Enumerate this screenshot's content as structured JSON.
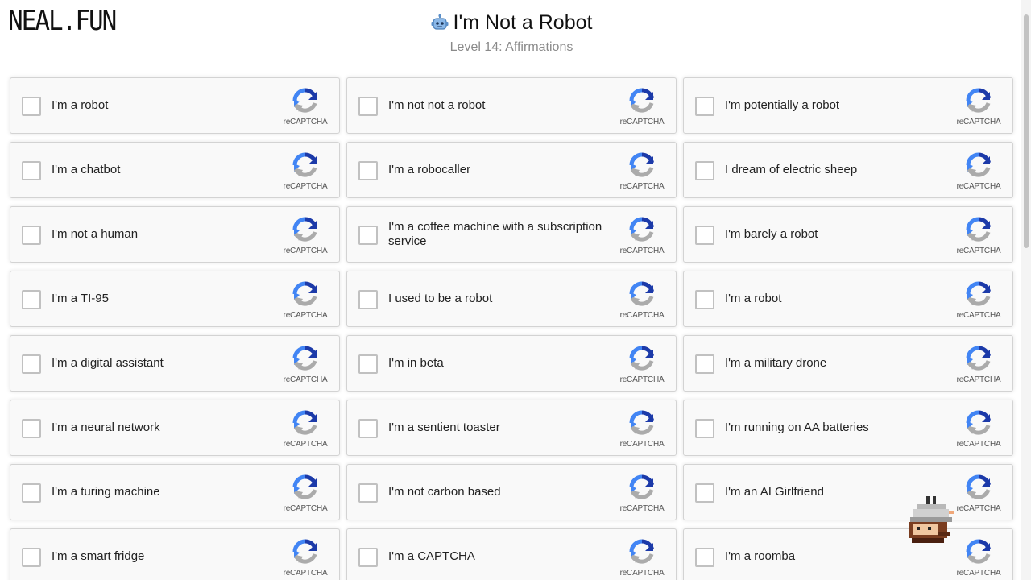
{
  "site": {
    "logo": "NEAL.FUN"
  },
  "header": {
    "title": "I'm Not a Robot",
    "title_icon": "robot-icon",
    "subtitle": "Level 14: Affirmations"
  },
  "recaptcha_label": "reCAPTCHA",
  "captchas": [
    {
      "label": "I'm a robot",
      "checked": false
    },
    {
      "label": "I'm not not a robot",
      "checked": false
    },
    {
      "label": "I'm potentially a robot",
      "checked": false
    },
    {
      "label": "I'm a chatbot",
      "checked": false
    },
    {
      "label": "I'm a robocaller",
      "checked": false
    },
    {
      "label": "I dream of electric sheep",
      "checked": false
    },
    {
      "label": "I'm not a human",
      "checked": false
    },
    {
      "label": "I'm a coffee machine with a subscription service",
      "checked": false
    },
    {
      "label": "I'm barely a robot",
      "checked": false
    },
    {
      "label": "I'm a TI-95",
      "checked": false
    },
    {
      "label": "I used to be a robot",
      "checked": false
    },
    {
      "label": "I'm a robot",
      "checked": false
    },
    {
      "label": "I'm a digital assistant",
      "checked": false
    },
    {
      "label": "I'm in beta",
      "checked": false
    },
    {
      "label": "I'm a military drone",
      "checked": false
    },
    {
      "label": "I'm a neural network",
      "checked": false
    },
    {
      "label": "I'm a sentient toaster",
      "checked": false
    },
    {
      "label": "I'm running on AA batteries",
      "checked": false
    },
    {
      "label": "I'm a turing machine",
      "checked": false
    },
    {
      "label": "I'm not carbon based",
      "checked": false
    },
    {
      "label": "I'm an AI Girlfriend",
      "checked": false
    },
    {
      "label": "I'm a smart fridge",
      "checked": false
    },
    {
      "label": "I'm a CAPTCHA",
      "checked": false
    },
    {
      "label": "I'm a roomba",
      "checked": false
    }
  ],
  "colors": {
    "recaptcha_blue": "#1c3aa9",
    "recaptcha_light_blue": "#4285f4",
    "recaptcha_gray": "#ababab",
    "card_background": "#f9f9f9",
    "card_border": "#d3d3d3",
    "checkbox_border": "#c1c1c1"
  }
}
